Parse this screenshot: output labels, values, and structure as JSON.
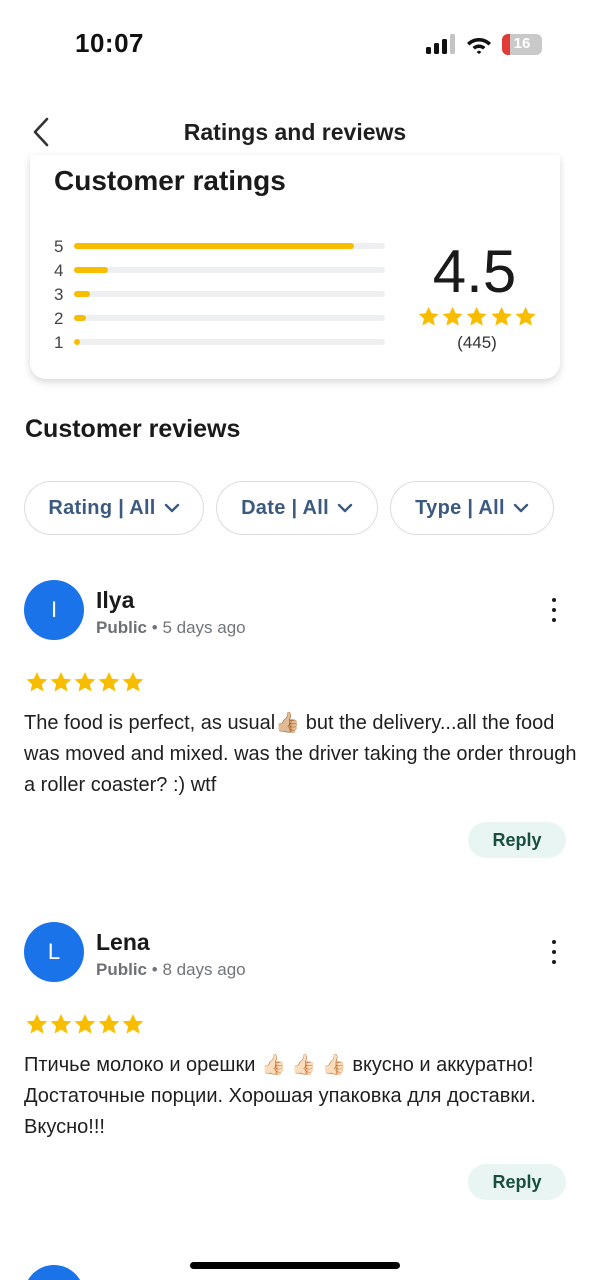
{
  "status_bar": {
    "time": "10:07",
    "battery_level": "16"
  },
  "header": {
    "title": "Ratings and reviews"
  },
  "ratings": {
    "title": "Customer ratings",
    "average": "4.5",
    "average_stars": 5,
    "count": "(445)",
    "bars": [
      {
        "label": "5",
        "fraction": 0.9
      },
      {
        "label": "4",
        "fraction": 0.11
      },
      {
        "label": "3",
        "fraction": 0.05
      },
      {
        "label": "2",
        "fraction": 0.04
      },
      {
        "label": "1",
        "fraction": 0.015
      }
    ]
  },
  "reviews_section": {
    "title": "Customer reviews"
  },
  "filters": [
    {
      "label": "Rating | All"
    },
    {
      "label": "Date | All"
    },
    {
      "label": "Type | All"
    }
  ],
  "reviews": [
    {
      "initial": "I",
      "name": "Ilya",
      "visibility": "Public",
      "time_ago": "5 days ago",
      "stars": 5,
      "text": "The food is perfect, as usual👍🏼  but the delivery...all the food was moved and mixed. was the driver taking the order through a roller coaster? :) wtf",
      "reply_label": "Reply"
    },
    {
      "initial": "L",
      "name": "Lena",
      "visibility": "Public",
      "time_ago": "8 days ago",
      "stars": 5,
      "text": "Птичье молоко и орешки 👍🏻 👍🏻 👍🏻 вкусно и аккуратно! Достаточные порции. Хорошая упаковка для доставки. Вкусно!!!",
      "reply_label": "Reply"
    }
  ],
  "colors": {
    "star": "#f9bd00",
    "bar_track": "#eeeff1",
    "avatar": "#1a73e8",
    "chip_text": "#3c5a80",
    "reply_bg": "#e9f5f3",
    "reply_text": "#1a4f3f",
    "battery_low": "#e03b35"
  },
  "icons": {
    "back": "chevron-left-icon",
    "more": "more-vert-icon",
    "filter_chevron": "chevron-down-icon",
    "star": "star-icon",
    "signal": "cellular-signal-icon",
    "wifi": "wifi-icon",
    "battery": "battery-icon"
  }
}
